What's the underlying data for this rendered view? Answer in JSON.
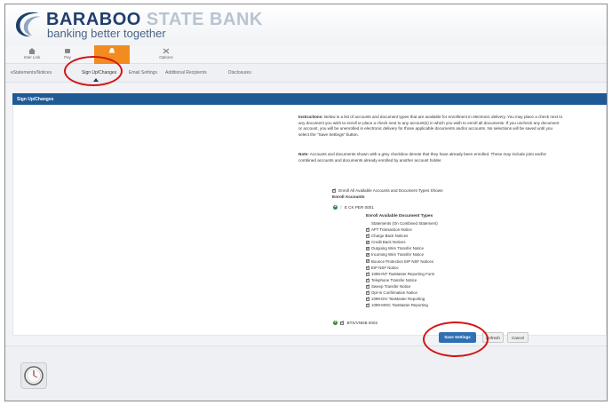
{
  "header": {
    "bank_name_main": "BARABOO",
    "bank_name_light": "STATE BANK",
    "tagline": "banking better together"
  },
  "nav": {
    "items": [
      {
        "label": "Inter Link",
        "icon": "home-icon"
      },
      {
        "label": "Pay",
        "icon": "pay-icon"
      },
      {
        "label": "",
        "icon": "bell-icon",
        "active": true
      },
      {
        "label": "Options",
        "icon": "options-icon"
      }
    ]
  },
  "subnav": {
    "items": [
      {
        "label": "eStatements/Notices"
      },
      {
        "label": "Sign Up/Changes",
        "active": true
      },
      {
        "label": "Email Settings"
      },
      {
        "label": "Additional Recipients"
      },
      {
        "label": "Disclosures"
      }
    ]
  },
  "section": {
    "title": "Sign Up/Changes"
  },
  "instructions": {
    "label": "Instructions:",
    "text": "Below is a list of accounts and document types that are available for enrollment in electronic delivery. You may place a check next to any document you wish to enroll or place a check next to any account(s) in which you wish to enroll all documents. If you uncheck any document or account, you will be unenrolled in electronic delivery for those applicable documents and/or accounts. No selections will be saved until you select the \"Save Settings\" button."
  },
  "note": {
    "label": "Note:",
    "text": "Accounts and documents shown with a grey checkbox denote that they have already been enrolled. These may include joint and/or combined accounts and documents already enrolled by another account holder."
  },
  "enroll_all_label": "Enroll All Available Accounts and Document Types Shown",
  "enroll_accounts_label": "Enroll Accounts",
  "accounts": [
    {
      "name": "E CK PER 0001"
    },
    {
      "name": "BTS/VNDB 0002"
    }
  ],
  "doc_types_header": "Enroll Available Document Types",
  "doc_types": [
    {
      "label": "Statements (On Combined Statement)",
      "checkbox": false
    },
    {
      "label": "AFT Transaction Notice",
      "checkbox": true
    },
    {
      "label": "Charge Back Notices",
      "checkbox": true
    },
    {
      "label": "Credit Back Notices",
      "checkbox": true
    },
    {
      "label": "Outgoing Wire Transfer Notice",
      "checkbox": true
    },
    {
      "label": "Incoming Wire Transfer Notice",
      "checkbox": true
    },
    {
      "label": "Bounce Protection EIP NSF Notices",
      "checkbox": true
    },
    {
      "label": "EIP NSF Notice",
      "checkbox": true
    },
    {
      "label": "1099-INT TaxMaster Reporting Form",
      "checkbox": true
    },
    {
      "label": "Telephone Transfer Notice",
      "checkbox": true
    },
    {
      "label": "Sweep Transfer Notice",
      "checkbox": true
    },
    {
      "label": "Opt-In Confirmation Notice",
      "checkbox": true
    },
    {
      "label": "1099-DIV TaxMaster Reporting",
      "checkbox": true
    },
    {
      "label": "1099-MISC TaxMaster Reporting",
      "checkbox": true
    }
  ],
  "buttons": {
    "save": "Save Settings",
    "refresh": "Refresh",
    "cancel": "Cancel"
  },
  "colors": {
    "brand_navy": "#1f3f6b",
    "section_bar": "#1f5a95",
    "nav_active": "#f28c1e",
    "save_button": "#2e6fb4",
    "annotation_red": "#d41414"
  }
}
